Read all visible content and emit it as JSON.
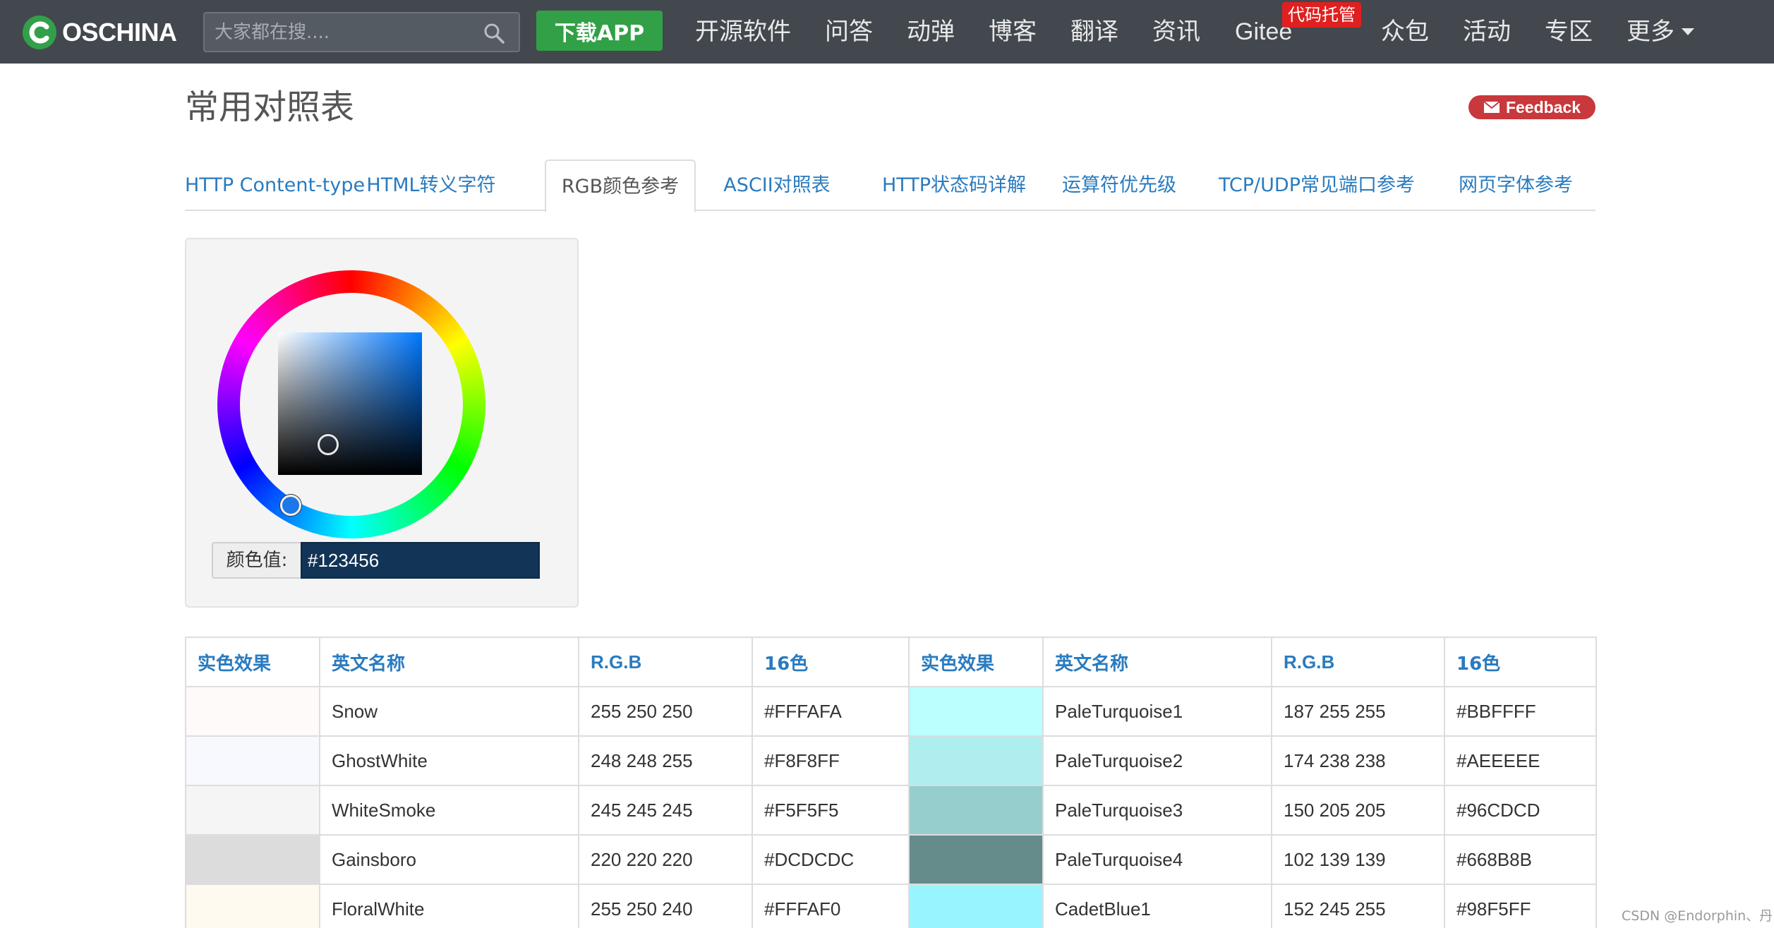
{
  "nav": {
    "logo_text": "OSCHINA",
    "search_placeholder": "大家都在搜....",
    "app_button": "下载APP",
    "items": [
      "开源软件",
      "问答",
      "动弹",
      "博客",
      "翻译",
      "资讯",
      "Gitee",
      "众包",
      "活动",
      "专区",
      "更多"
    ],
    "gitee_badge": "代码托管",
    "colors": {
      "bar": "#43484e",
      "app_button": "#31a046",
      "badge": "#e02020"
    }
  },
  "page": {
    "title": "常用对照表",
    "feedback": "Feedback"
  },
  "tabs": [
    {
      "label": "HTTP Content-type",
      "active": false
    },
    {
      "label": "HTML转义字符",
      "active": false
    },
    {
      "label": "RGB颜色参考",
      "active": true
    },
    {
      "label": "ASCII对照表",
      "active": false
    },
    {
      "label": "HTTP状态码详解",
      "active": false
    },
    {
      "label": "运算符优先级",
      "active": false
    },
    {
      "label": "TCP/UDP常见端口参考",
      "active": false
    },
    {
      "label": "网页字体参考",
      "active": false
    }
  ],
  "picker": {
    "label": "颜色值:",
    "value": "#123456"
  },
  "table": {
    "headers": [
      "实色效果",
      "英文名称",
      "R.G.B",
      "16色",
      "实色效果",
      "英文名称",
      "R.G.B",
      "16色"
    ],
    "rows": [
      {
        "left": {
          "name": "Snow",
          "rgb": "255 250 250",
          "hex": "#FFFAFA"
        },
        "right": {
          "name": "PaleTurquoise1",
          "rgb": "187 255 255",
          "hex": "#BBFFFF"
        }
      },
      {
        "left": {
          "name": "GhostWhite",
          "rgb": "248 248 255",
          "hex": "#F8F8FF"
        },
        "right": {
          "name": "PaleTurquoise2",
          "rgb": "174 238 238",
          "hex": "#AEEEEE"
        }
      },
      {
        "left": {
          "name": "WhiteSmoke",
          "rgb": "245 245 245",
          "hex": "#F5F5F5"
        },
        "right": {
          "name": "PaleTurquoise3",
          "rgb": "150 205 205",
          "hex": "#96CDCD"
        }
      },
      {
        "left": {
          "name": "Gainsboro",
          "rgb": "220 220 220",
          "hex": "#DCDCDC"
        },
        "right": {
          "name": "PaleTurquoise4",
          "rgb": "102 139 139",
          "hex": "#668B8B"
        }
      },
      {
        "left": {
          "name": "FloralWhite",
          "rgb": "255 250 240",
          "hex": "#FFFAF0"
        },
        "right": {
          "name": "CadetBlue1",
          "rgb": "152 245 255",
          "hex": "#98F5FF"
        }
      }
    ]
  },
  "watermark": "CSDN @Endorphin、丹"
}
